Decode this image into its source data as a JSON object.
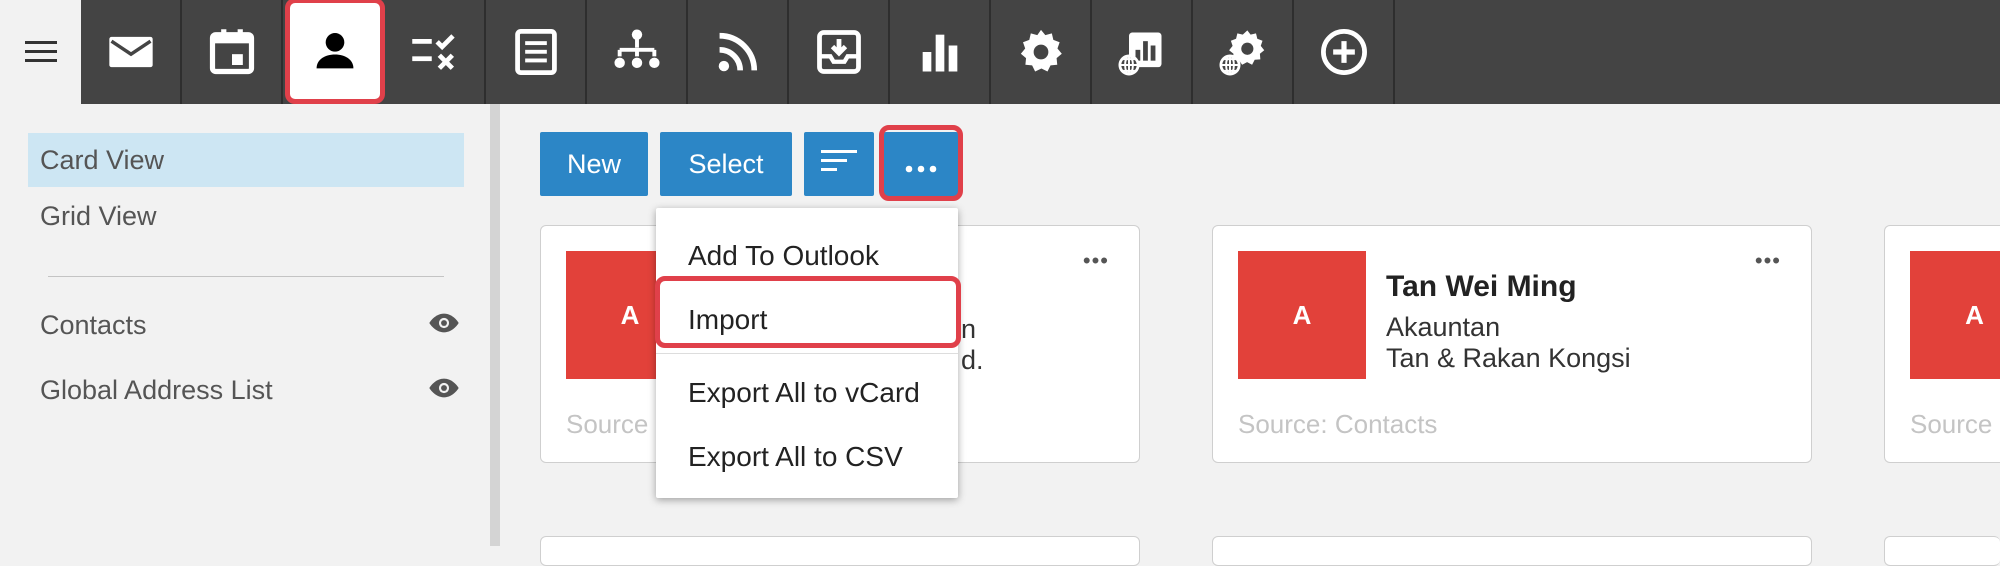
{
  "toolbar": {
    "icons": [
      "mail-icon",
      "calendar-icon",
      "contacts-icon",
      "tasks-icon",
      "notes-icon",
      "org-chart-icon",
      "rss-feed-icon",
      "inbox-download-icon",
      "reports-bar-chart-icon",
      "settings-gear-icon",
      "global-reports-icon",
      "global-settings-icon",
      "add-circle-icon"
    ],
    "active_index": 2
  },
  "sidebar": {
    "views": [
      {
        "label": "Card View",
        "selected": true
      },
      {
        "label": "Grid View",
        "selected": false
      }
    ],
    "sources": [
      {
        "label": "Contacts",
        "icon": "eye-icon"
      },
      {
        "label": "Global Address List",
        "icon": "eye-icon"
      }
    ]
  },
  "actions": {
    "new_label": "New",
    "select_label": "Select",
    "sort_icon": "sort-icon",
    "more_icon": "more-horizontal-icon"
  },
  "menu": {
    "items": [
      "Add To Outlook",
      "Import",
      "Export All to vCard",
      "Export All to CSV"
    ],
    "highlighted": "Import"
  },
  "cards": [
    {
      "initial": "A",
      "line1_tail": "n",
      "line2_tail": "d.",
      "source": "Source: Contacts",
      "source_visible": "Source"
    },
    {
      "initial": "A",
      "name": "Tan Wei Ming",
      "title": "Akauntan",
      "company": "Tan & Rakan Kongsi",
      "source": "Source: Contacts"
    },
    {
      "initial": "A",
      "source_visible": "Source"
    }
  ],
  "colors": {
    "toolbar_bg": "#444444",
    "accent": "#2c86c6",
    "avatar": "#e2413a",
    "highlight_ring": "#e0404a",
    "selected_view": "#cde6f3"
  }
}
